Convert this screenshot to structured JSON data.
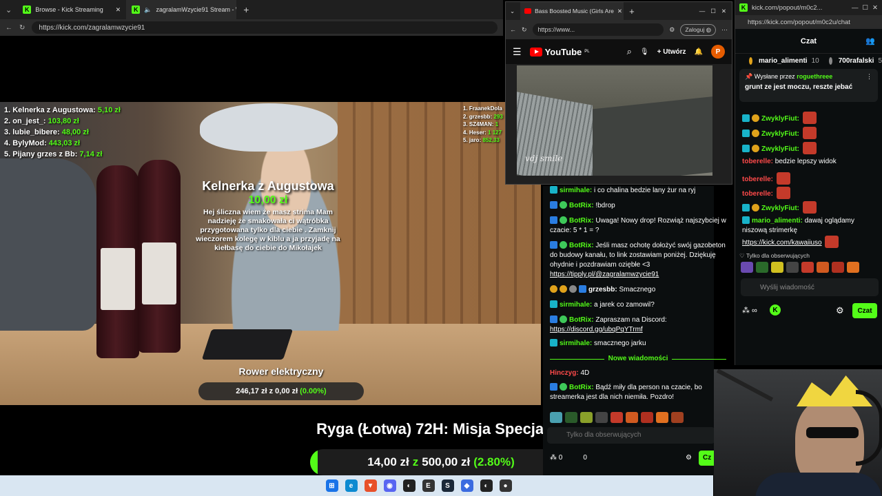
{
  "main_browser": {
    "tabs": [
      {
        "label": "Browse - Kick Streaming"
      },
      {
        "label": "zagralamWzycie91 Stream - W"
      }
    ],
    "url": "https://kick.com/zagralamwzycie91"
  },
  "overlay": {
    "top_donors": [
      {
        "name": "1. Kelnerka z Augustowa:",
        "amount": "5,10 zł"
      },
      {
        "name": "2. on_jest_:",
        "amount": "103,80 zł"
      },
      {
        "name": "3. lubie_bibere:",
        "amount": "48,00 zł"
      },
      {
        "name": "4. BylyMod:",
        "amount": "443,03 zł"
      },
      {
        "name": "5. Pijany grzes z Bb:",
        "amount": "7,14 zł"
      }
    ],
    "top_right": [
      {
        "name": "1. FraanekDola",
        "amount": ""
      },
      {
        "name": "2. grzesbb:",
        "amount": "293"
      },
      {
        "name": "3. SZ4MAN:",
        "amount": "1"
      },
      {
        "name": "4. Heser:",
        "amount": "1 127"
      },
      {
        "name": "5. jaro:",
        "amount": "852,33"
      }
    ],
    "alert": {
      "name": "Kelnerka z Augustowa",
      "amount": "10,00 zł",
      "message": "Hej śliczna wiem że masz strima Mam nadzieję że smakowała ci wątróbka przygotowana tylko dla ciebie . Zamknij wieczorem kolegę w kiblu a ja przyjadę na kiełbasę do ciebie do Mikołajek"
    },
    "goal_small": {
      "title": "Rower elektryczny",
      "text": "246,17 zł z 0,00 zł",
      "pct": "(0.00%)"
    },
    "goal_big": {
      "title": "Ryga (Łotwa) 72H: Misja Specjalna",
      "current": "14,00 zł",
      "z": "z",
      "target": "500,00 zł",
      "pct": "(2.80%)",
      "progress": 0.028
    }
  },
  "youtube_window": {
    "tab_label": "Bass Boosted Music (Girls Are",
    "url": "https://www...",
    "login_label": "Zaloguj",
    "logo_text": "YouTube",
    "logo_sup": "PL",
    "create_label": "Utwórz",
    "avatar_letter": "P",
    "watermark": "vdj smile"
  },
  "main_chat": {
    "messages": [
      {
        "user": "sirmihale:",
        "text": "i co chalina bedzie lany żur na ryj"
      },
      {
        "user": "BotRix:",
        "text": "!bdrop"
      },
      {
        "user": "BotRix:",
        "text": "Uwaga! Nowy drop! Rozwiąż najszybciej w czacie: 5 * 1 = ?"
      },
      {
        "user": "BotRix:",
        "text": "Jeśli masz ochotę dołożyć swój gazobeton do budowy kanału, to link zostawiam poniżej. Dziękuję ohydnie i pozdrawiam oziębłe <3",
        "link": "https://tipply.pl/@zagralamwzycie91"
      },
      {
        "user": "grzesbb:",
        "text": "Smacznego"
      },
      {
        "user": "sirmihale:",
        "text": "a jarek co zamowil?"
      },
      {
        "user": "BotRix:",
        "text": "Zapraszam na Discord:",
        "link": "https://discord.gg/ubqPqYTrmf"
      },
      {
        "user": "sirmihale:",
        "text": "smacznego jarku"
      },
      {
        "user": "Hinczyg:",
        "text": "4D"
      },
      {
        "user": "BotRix:",
        "text": "Bądź miły dla person na czacie, bo streamerka jest dla nich niemiła. Pozdro!"
      }
    ],
    "divider": "Nowe wiadomości",
    "input_placeholder": "Tylko dla obserwujących",
    "footer_points": "0",
    "footer_count": "0",
    "send_label": "Cz"
  },
  "popout": {
    "title_url": "kick.com/popout/m0c2...",
    "url": "https://kick.com/popout/m0c2u/chat",
    "header": "Czat",
    "top_users": [
      {
        "name": "mario_alimenti",
        "count": "10"
      },
      {
        "name": "700rafalski",
        "count": "5"
      }
    ],
    "pinned_by_label": "Wysłane przez",
    "pinned_by_user": "roguethreee",
    "pinned_text": "grunt ze jest moczu, reszte jebać",
    "messages": [
      {
        "user": "ZwyklyFiut:",
        "text": ""
      },
      {
        "user": "ZwyklyFiut:",
        "text": ""
      },
      {
        "user": "ZwyklyFiut:",
        "text": ""
      },
      {
        "user": "toberelle:",
        "text": "bedzie lepszy widok"
      },
      {
        "user": "toberelle:",
        "text": ""
      },
      {
        "user": "toberelle:",
        "text": ""
      },
      {
        "user": "ZwyklyFiut:",
        "text": ""
      },
      {
        "user": "mario_alimenti:",
        "text": "dawaj oglądamy niszową strimerkę",
        "link": "https://kick.com/kawaiiuso"
      }
    ],
    "follow_only": "Tylko dla obserwujących",
    "input_placeholder": "Wyślij wiadomość",
    "send_label": "Czat"
  },
  "colors": {
    "kick_green": "#53fc18",
    "chat_bg": "#0b0e0f",
    "youtube_red": "#ff0000"
  }
}
